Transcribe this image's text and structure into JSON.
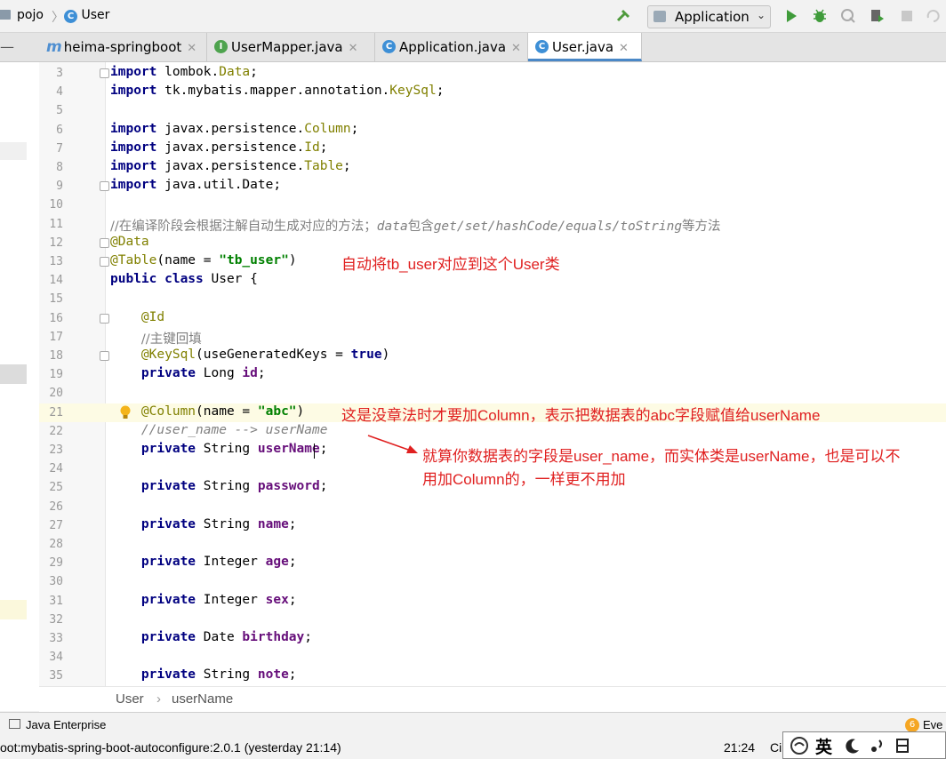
{
  "nav": {
    "crumb1": "pojo",
    "crumb2": "User",
    "run_config": "Application"
  },
  "tabs": [
    {
      "label": "heima-springboot"
    },
    {
      "label": "UserMapper.java"
    },
    {
      "label": "Application.java"
    },
    {
      "label": "User.java"
    }
  ],
  "code_lines": [
    {
      "n": "3"
    },
    {
      "n": "4"
    },
    {
      "n": "5"
    },
    {
      "n": "6"
    },
    {
      "n": "7"
    },
    {
      "n": "8"
    },
    {
      "n": "9"
    },
    {
      "n": "10"
    },
    {
      "n": "11"
    },
    {
      "n": "12"
    },
    {
      "n": "13"
    },
    {
      "n": "14"
    },
    {
      "n": "15"
    },
    {
      "n": "16"
    },
    {
      "n": "17"
    },
    {
      "n": "18"
    },
    {
      "n": "19"
    },
    {
      "n": "20"
    },
    {
      "n": "21"
    },
    {
      "n": "22"
    },
    {
      "n": "23"
    },
    {
      "n": "24"
    },
    {
      "n": "25"
    },
    {
      "n": "26"
    },
    {
      "n": "27"
    },
    {
      "n": "28"
    },
    {
      "n": "29"
    },
    {
      "n": "30"
    },
    {
      "n": "31"
    },
    {
      "n": "32"
    },
    {
      "n": "33"
    },
    {
      "n": "34"
    },
    {
      "n": "35"
    }
  ],
  "code": {
    "l3_kw": "import",
    "l3_pkg": " lombok.",
    "l3_cls": "Data",
    "l3_end": ";",
    "l4_kw": "import",
    "l4_pkg": " tk.mybatis.mapper.annotation.",
    "l4_cls": "KeySql",
    "l4_end": ";",
    "l6_kw": "import",
    "l6_pkg": " javax.persistence.",
    "l6_cls": "Column",
    "l6_end": ";",
    "l7_kw": "import",
    "l7_pkg": " javax.persistence.",
    "l7_cls": "Id",
    "l7_end": ";",
    "l8_kw": "import",
    "l8_pkg": " javax.persistence.",
    "l8_cls": "Table",
    "l8_end": ";",
    "l9_kw": "import",
    "l9_rest": " java.util.Date;",
    "l11_a": "//在编译阶段会根据注解自动生成对应的方法；",
    "l11_b": "data",
    "l11_c": "包含",
    "l11_d": "get/set/hashCode/equals/toString",
    "l11_e": "等方法",
    "l12": "@Data",
    "l13_ann": "@Table",
    "l13_a": "(name = ",
    "l13_str": "\"tb_user\"",
    "l13_b": ")",
    "l14_kw": "public class",
    "l14_rest": " User {",
    "l16": "@Id",
    "l17": "//主键回填",
    "l18_ann": "@KeySql",
    "l18_a": "(useGeneratedKeys = ",
    "l18_kw": "true",
    "l18_b": ")",
    "l19_kw": "private",
    "l19_t": " Long ",
    "l19_f": "id",
    "l19_end": ";",
    "l21_ann": "@Column",
    "l21_a": "(name = ",
    "l21_str": "\"abc\"",
    "l21_b": ")",
    "l22": "//user_name --> userName",
    "l23_kw": "private",
    "l23_t": " String ",
    "l23_f": "userName",
    "l23_end": ";",
    "l25_kw": "private",
    "l25_t": " String ",
    "l25_f": "password",
    "l25_end": ";",
    "l27_kw": "private",
    "l27_t": " String ",
    "l27_f": "name",
    "l27_end": ";",
    "l29_kw": "private",
    "l29_t": " Integer ",
    "l29_f": "age",
    "l29_end": ";",
    "l31_kw": "private",
    "l31_t": " Integer ",
    "l31_f": "sex",
    "l31_end": ";",
    "l33_kw": "private",
    "l33_t": " Date ",
    "l33_f": "birthday",
    "l33_end": ";",
    "l35_kw": "private",
    "l35_t": " String ",
    "l35_f": "note",
    "l35_end": ";"
  },
  "notes": {
    "n1": "自动将tb_user对应到这个User类",
    "n2": "这是没章法时才要加Column，表示把数据表的abc字段赋值给userName",
    "n3a": "就算你数据表的字段是user_name，而实体类是userName，也是可以不",
    "n3b": "用加Column的，一样更不用加"
  },
  "breadcrumb": {
    "class": "User",
    "sep": "›",
    "member": "userName"
  },
  "bottom": {
    "java_enterprise": "Java Enterprise",
    "event_badge": "6",
    "event_label": "Eve"
  },
  "status": {
    "message": "oot:mybatis-spring-boot-autoconfigure:2.0.1 (yesterday 21:14)",
    "position": "21:24",
    "encoding": "Ci",
    "ime_char": "英"
  },
  "colors": {
    "accent": "#4a88c7",
    "note_red": "#e02020",
    "keyword": "#000080",
    "string": "#008000",
    "field": "#660e7a",
    "annotation": "#808000"
  }
}
